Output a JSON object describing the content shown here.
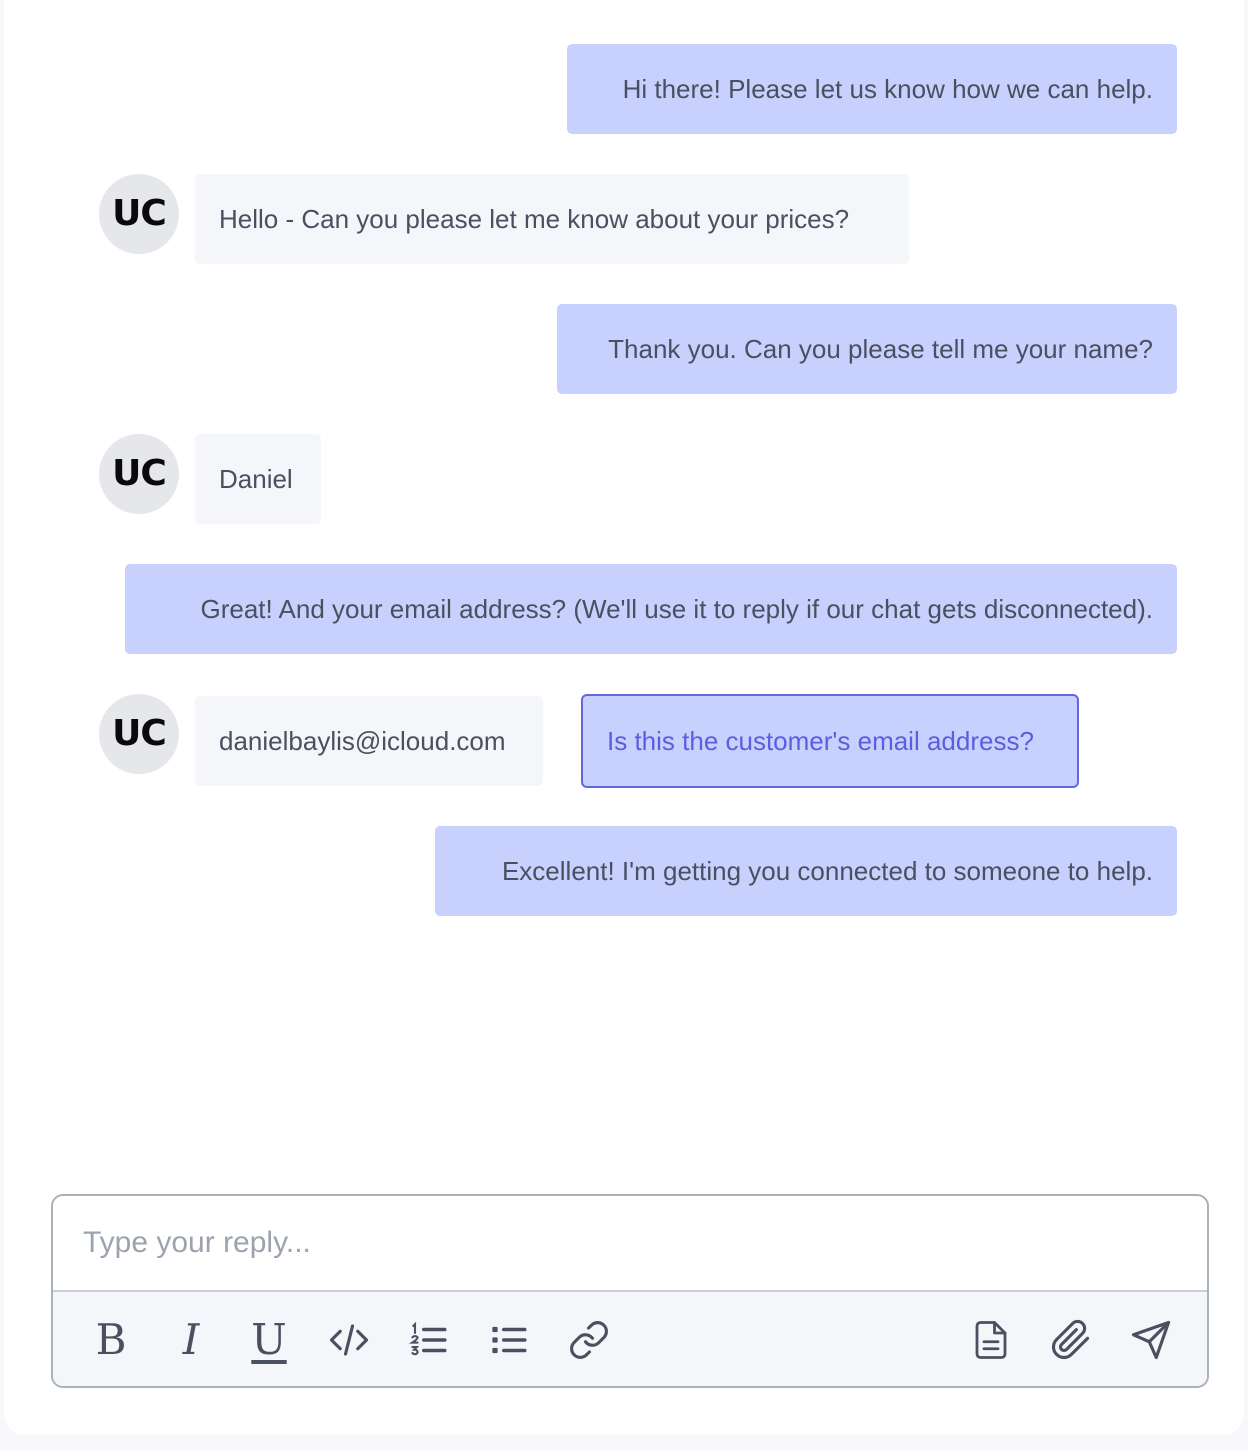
{
  "conversation": {
    "messages": [
      {
        "sender": "agent",
        "text": "Hi there! Please let us know how we can help."
      },
      {
        "sender": "customer",
        "avatar": "UC",
        "text": "Hello - Can you please let me know about your prices?"
      },
      {
        "sender": "agent",
        "text": "Thank you. Can you please tell me your name?"
      },
      {
        "sender": "customer",
        "avatar": "UC",
        "text": "Daniel"
      },
      {
        "sender": "agent",
        "text": "Great! And your email address? (We'll use it to reply if our chat gets disconnected)."
      },
      {
        "sender": "customer",
        "avatar": "UC",
        "text": "danielbaylis@icloud.com"
      },
      {
        "sender": "agent",
        "text": "Excellent! I'm getting you connected to someone to help."
      }
    ],
    "email_suggestion": "Is this the customer's email address?"
  },
  "composer": {
    "placeholder": "Type your reply...",
    "value": ""
  },
  "toolbar": {
    "bold_glyph": "B",
    "italic_glyph": "I",
    "underline_glyph": "U",
    "icons": [
      "bold-icon",
      "italic-icon",
      "underline-icon",
      "code-icon",
      "ordered-list-icon",
      "bullet-list-icon",
      "link-icon",
      "document-icon",
      "paperclip-icon",
      "send-icon"
    ]
  },
  "colors": {
    "agent_bubble": "#c8d0fd",
    "customer_bubble": "#f4f6f9",
    "suggestion_border": "#6366e0",
    "suggestion_text": "#5a5ee0",
    "avatar_bg": "#e6e7ea"
  }
}
